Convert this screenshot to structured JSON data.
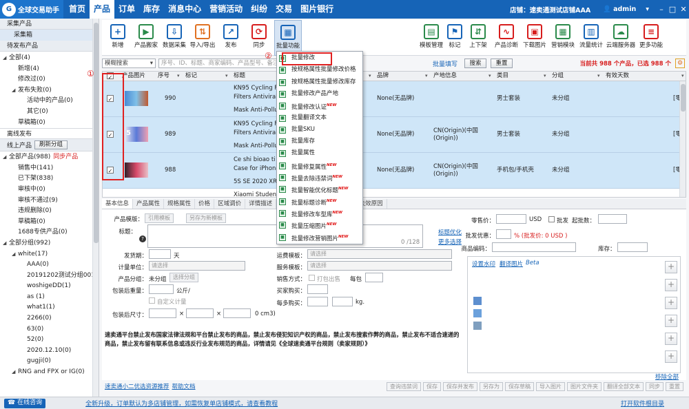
{
  "app": {
    "logo": "全球交易助手",
    "nav": [
      "首页",
      "产品",
      "订单",
      "库存",
      "消息中心",
      "营销活动",
      "纠纷",
      "交易",
      "图片银行"
    ],
    "active_nav": "产品",
    "store": "店铺：速卖通测试店铺AAA",
    "user": "admin"
  },
  "sidebar": {
    "collect_title": "采集产品",
    "collect_item": "采集箱",
    "pending_title": "待发布产品",
    "pending_tree": [
      {
        "t": "全部(4)",
        "lv": 0,
        "tri": true
      },
      {
        "t": "新增(4)",
        "lv": 1
      },
      {
        "t": "修改过(0)",
        "lv": 1
      },
      {
        "t": "发布失败(0)",
        "lv": 1,
        "tri": true
      },
      {
        "t": "活动中的产品(0)",
        "lv": 2
      },
      {
        "t": "其它(0)",
        "lv": 2
      },
      {
        "t": "草稿箱(0)",
        "lv": 1
      }
    ],
    "offline": "离线发布",
    "online_title": "线上产品",
    "refresh_group": "刷新分组",
    "online_tree": [
      {
        "t": "全部产品(988)",
        "lv": 0,
        "tri": true,
        "extra": "同步产品"
      },
      {
        "t": "销售中(141)",
        "lv": 1
      },
      {
        "t": "已下架(838)",
        "lv": 1
      },
      {
        "t": "审核中(0)",
        "lv": 1
      },
      {
        "t": "审核不通过(9)",
        "lv": 1
      },
      {
        "t": "违规删除(0)",
        "lv": 1
      },
      {
        "t": "草稿箱(0)",
        "lv": 1
      },
      {
        "t": "1688专供产品(0)",
        "lv": 1
      },
      {
        "t": "全部分组(992)",
        "lv": 0,
        "tri": true
      },
      {
        "t": "white(17)",
        "lv": 1,
        "tri": true
      },
      {
        "t": "AAA(0)",
        "lv": 2
      },
      {
        "t": "20191202测试分组001",
        "lv": 2
      },
      {
        "t": "woshigeDD(1)",
        "lv": 2
      },
      {
        "t": "as (1)",
        "lv": 2
      },
      {
        "t": "what1(1)",
        "lv": 2
      },
      {
        "t": "2266(0)",
        "lv": 2
      },
      {
        "t": "63(0)",
        "lv": 2
      },
      {
        "t": "52(0)",
        "lv": 2
      },
      {
        "t": "2020.12.10(0)",
        "lv": 2
      },
      {
        "t": "gugji(0)",
        "lv": 2
      },
      {
        "t": "RNG and FPX or IG(0)",
        "lv": 1,
        "tri": true
      }
    ]
  },
  "toolbar": {
    "left": [
      {
        "t": "新增",
        "ic": "+",
        "c": "#1664b7"
      },
      {
        "t": "产品搬家",
        "ic": "▶",
        "c": "#2a8a4a"
      },
      {
        "t": "数据采集",
        "ic": "⇩",
        "c": "#1664b7"
      },
      {
        "t": "导入/导出",
        "ic": "⇅",
        "c": "#e07020"
      },
      {
        "t": "发布",
        "ic": "↗",
        "c": "#1664b7"
      },
      {
        "t": "同步",
        "ic": "⟳",
        "c": "#d71c1c"
      },
      {
        "t": "批量功能",
        "ic": "▦",
        "c": "#1664b7"
      }
    ],
    "right": [
      {
        "t": "模板管理",
        "ic": "▤",
        "c": "#2a8a4a"
      },
      {
        "t": "标记",
        "ic": "⚑",
        "c": "#1664b7"
      },
      {
        "t": "上下架",
        "ic": "⇵",
        "c": "#2a8a4a"
      },
      {
        "t": "产品诊断",
        "ic": "∿",
        "c": "#d71c1c"
      },
      {
        "t": "下载图片",
        "ic": "▣",
        "c": "#d71c1c"
      },
      {
        "t": "营销模块",
        "ic": "▦",
        "c": "#2a8a4a"
      },
      {
        "t": "流量统计",
        "ic": "▥",
        "c": "#1664b7"
      },
      {
        "t": "云端服务器",
        "ic": "☁",
        "c": "#2a8a4a"
      },
      {
        "t": "更多功能",
        "ic": "≡",
        "c": "#d71c1c"
      }
    ]
  },
  "filter": {
    "mode": "模糊搜索",
    "placeholder": "序号、ID、标题、商家编码、产品型号、备注",
    "batch_fill": "批量填写",
    "search": "搜索",
    "reset": "重置",
    "count_pre": "当前共",
    "count_n": "988",
    "count_mid": "个产品，已选",
    "count_sel": "988",
    "count_post": "个"
  },
  "grid": {
    "headers": [
      "产品图片",
      "序号",
      "标记",
      "标题",
      "品牌",
      "产地信息",
      "类目",
      "分组",
      "有效天数"
    ],
    "rows": [
      {
        "seq": "990",
        "title": [
          "KN95 Cycling Fa",
          "Filters Antiviral 5",
          "Mask Anti-Pollu"
        ],
        "brand": "None(无品牌)",
        "origin": "",
        "cat": "男士套装",
        "group": "未分组",
        "days": "[零"
      },
      {
        "seq": "989",
        "title": [
          "KN95 Cycling Fa",
          "Filters Antiviral 5",
          "Mask Anti-Pollu"
        ],
        "brand": "None(无品牌)",
        "origin": "CN(Origin)(中国\n(Origin))",
        "cat": "男士套装",
        "group": "未分组",
        "days": "[零"
      },
      {
        "seq": "988",
        "title": [
          "Ce shi bioao ti b",
          "Case for iPhone",
          "5S SE 2020 XR c"
        ],
        "brand": "None(无品牌)",
        "origin": "CN(Origin)(中国\n(Origin))",
        "cat": "手机包/手机壳",
        "group": "未分组",
        "days": "[零"
      }
    ],
    "next_title": "Xiaomi Students",
    "thumb_num": "5"
  },
  "tabs": [
    "基本信息",
    "产品属性",
    "规格属性",
    "价格",
    "区域调价",
    "详情描述",
    "自定义信息",
    "流量统计",
    "产品失效原因"
  ],
  "form": {
    "template_lbl": "产品模版：",
    "ref_tpl": "引用模板",
    "save_tpl": "另存为新模板",
    "title_lbl": "标题：",
    "title_count": "0 /128",
    "title_opt": "标题优化",
    "more_sel": "更多选择",
    "ship_lbl": "发货期：",
    "day": "天",
    "unit_lbl": "计量单位：",
    "unit_ph": "请选择",
    "group_lbl": "产品分组：",
    "group_val": "未分组",
    "group_sel": "选择分组",
    "weight_lbl": "包装后重量：",
    "kg": "公斤/",
    "custom_w": "自定义计量",
    "size_lbl": "包装后尺寸：",
    "x": "×",
    "cm": "0 cm3)",
    "freight_lbl": "运费模板：",
    "service_lbl": "服务模板：",
    "sel_ph": "请选择",
    "sale_lbl": "销售方式：",
    "pack": "打包出售",
    "per_pack": "每包",
    "buyer_lbl": "买家购买：",
    "more_lbl": "每多购买：",
    "kg2": "kg.",
    "retail_lbl": "零售价：",
    "usd": "USD",
    "wholesale": "批发",
    "min_lbl": "起批数：",
    "disc_lbl": "批发优惠：",
    "disc_note": "% (批发价: 0 USD )",
    "code_lbl": "商品编码：",
    "stock_lbl": "库存：",
    "watermark": "设置水印",
    "translate": "翻译图片",
    "beta": "Beta",
    "remove_all": "移除全部",
    "notice": "速卖通平台禁止发布国家法律法规和平台禁止发布的商品，禁止发布侵犯知识产权的商品，禁止发布搜索作弊的商品，禁止发布不适合速递的商品，禁止发布留有联系信息或违反行业发布规范的商品，详情请见《全球速卖通平台规则（卖家规则）》",
    "notice_link": "《全球速卖通平台规则（卖家规则）》"
  },
  "bottom": {
    "link1": "速卖通小二优选资源推荐",
    "link2": "帮助文档",
    "btns": [
      "查询违禁词",
      "保存",
      "保存并发布",
      "另存为",
      "保存草稿",
      "导入图片",
      "图片文件夹",
      "翻译全部文本",
      "同步",
      "重置"
    ]
  },
  "status": {
    "help": "在线咨询",
    "msg": "全新升级，订单默认为多店铺管理，如需恢复单店铺模式，请查看教程",
    "open_dir": "打开软件根目录"
  },
  "menu": [
    {
      "t": "批量修改",
      "new": false
    },
    {
      "t": "按规格属性批量修改价格",
      "new": false
    },
    {
      "t": "按规格属性批量修改库存",
      "new": false
    },
    {
      "t": "批量修改产品产地",
      "new": false
    },
    {
      "t": "批量修改认证",
      "new": true
    },
    {
      "t": "批量翻译文本",
      "new": false
    },
    {
      "t": "批量SKU",
      "new": false
    },
    {
      "t": "批量库存",
      "new": false
    },
    {
      "t": "批量属性",
      "new": false
    },
    {
      "t": "批量修复属性",
      "new": true
    },
    {
      "t": "批量去除违禁词",
      "new": true
    },
    {
      "t": "批量智能优化标题",
      "new": true
    },
    {
      "t": "批量标题诊断",
      "new": true
    },
    {
      "t": "批量修改车型库",
      "new": true
    },
    {
      "t": "批量压缩图片",
      "new": true
    },
    {
      "t": "批量修改营销图片",
      "new": true
    }
  ],
  "new_badge": "NEW",
  "annotations": {
    "one": "①",
    "two": "②"
  },
  "colors": {
    "nav": "#1664b7",
    "selected_row": "#cfe6f8",
    "annotation": "#e02020"
  }
}
